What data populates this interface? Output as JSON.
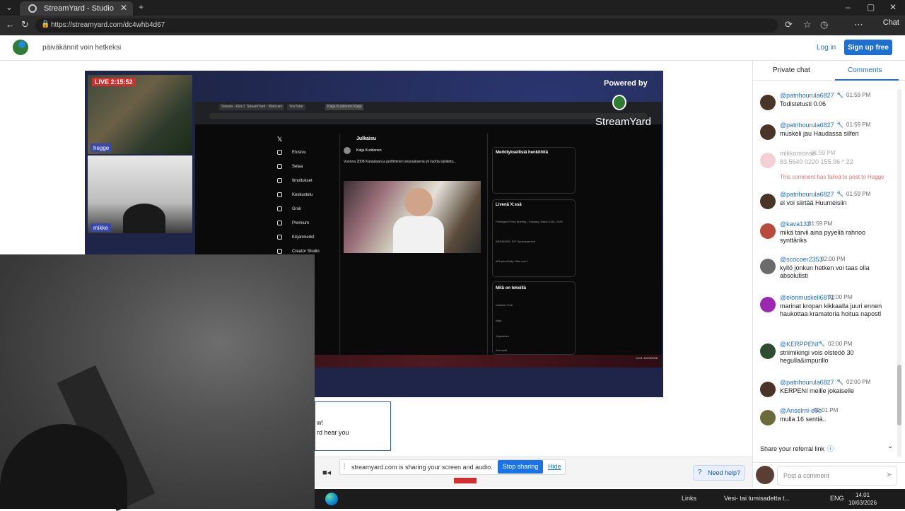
{
  "browser": {
    "tab_title": "StreamYard - Studio",
    "url": "https://streamyard.com/dc4whb4d67",
    "chat_label": "Chat",
    "icons": [
      "back-icon",
      "reload-icon",
      "zoom-icon",
      "star-icon",
      "extensions-icon",
      "favorites-icon",
      "history-icon",
      "menu-icon"
    ]
  },
  "header": {
    "stream_title": "päiväkännit voin hetkeksi",
    "login_label": "Log in",
    "signup_label": "Sign up free"
  },
  "stage": {
    "live_label": "LIVE 2:15:52",
    "cam1_name": "hegge",
    "cam2_name": "mikke",
    "powered_by": "Powered by",
    "brand": "StreamYard"
  },
  "shared_screen": {
    "tabs": [
      "Stream - Kick Dashboard",
      "StreamYard - Webcam",
      "YouTube",
      "Katja Kuridonen Katja"
    ],
    "nav": [
      "Etusivu",
      "Selaa",
      "Ilmoitukset",
      "Keskustelu",
      "Grok",
      "Premium",
      "Kirjanmerkit",
      "Creator Studio"
    ],
    "post_header": "Julkaisu",
    "author": "Katja Kuridonen",
    "post_text": "Vuonna 2008 Kanadaan ja junttiminen seurauksena yli vuotta sijoitettu...",
    "panels": [
      {
        "title": "Merkityksellisiä henkilöitä"
      },
      {
        "title": "Livenä X:ssä",
        "lines": [
          "Pentagon Press Briefing | Tuesday, March 10th, 2026",
          "BREAKING: IDF Spokesperson",
          "#FinanceDaily: War over?"
        ]
      },
      {
        "title": "Mitä on tekeillä",
        "lines": [
          "Vladimir Putin",
          "Italia",
          "Joyauksen",
          "Arhmadit"
        ]
      }
    ],
    "taskbar_clock": "14:01 10/03/2026"
  },
  "dialog": {
    "line1": "w!",
    "line2": "rd hear you"
  },
  "share_bar": {
    "message": "streamyard.com is sharing your screen and audio.",
    "stop_label": "Stop sharing",
    "hide_label": "Hide"
  },
  "help": {
    "label": "Need help?"
  },
  "chat": {
    "tab_private": "Private chat",
    "tab_comments": "Comments",
    "messages": [
      {
        "name": "@patrihourula6827",
        "time": "01:59 PM",
        "text": "Todistetusti 0.06",
        "color": "#4a3428"
      },
      {
        "name": "@patrihourula6827",
        "time": "01:59 PM",
        "text": "muskeli jau Haudassa silfen",
        "color": "#4a3428"
      },
      {
        "name": "mikkomonse",
        "time": "01:59 PM",
        "text": "83.5640 0220 155.96 * 22",
        "error": "This comment has failed to post to Hegge",
        "color": "#f2d0d6"
      },
      {
        "name": "@patrihourula6827",
        "time": "01:59 PM",
        "text": "ei voi siirtää Huumeisiin",
        "color": "#4a3428"
      },
      {
        "name": "@kava132",
        "time": "01:59 PM",
        "text": "mikä tarvii aina pyyeliä rahnoo synttäriks",
        "color": "#b84a3e"
      },
      {
        "name": "@scocoer2353",
        "time": "02:00 PM",
        "text": "kyllö jonkun hetken voi taas olla absolutisti",
        "color": "#6b6b6b"
      },
      {
        "name": "@elonmuskeli6871",
        "time": "02:00 PM",
        "text": "marinat kropan kikkaalla juuri ennen haukottaa kramatoria hoitua napostl",
        "color": "#9c27b0"
      },
      {
        "name": "@KERPPENI",
        "time": "02:00 PM",
        "text": "striimikingi vois olsteöö 30 hegulla&impurillo",
        "color": "#2e4d2e"
      },
      {
        "name": "@patrihourula6827",
        "time": "02:00 PM",
        "text": "KERPENI meille jokaiselle",
        "color": "#4a3428"
      },
      {
        "name": "@Anselmi-e9o",
        "time": "02:01 PM",
        "text": "mulla 16 sentiä..",
        "color": "#6a6a3a"
      }
    ],
    "referral_label": "Share your referral link",
    "comment_placeholder": "Post a comment"
  },
  "taskbar": {
    "links": "Links",
    "weather": "Vesi- tai lumisadetta t...",
    "lang": "ENG",
    "time": "14.01",
    "date": "10/03/2026"
  }
}
